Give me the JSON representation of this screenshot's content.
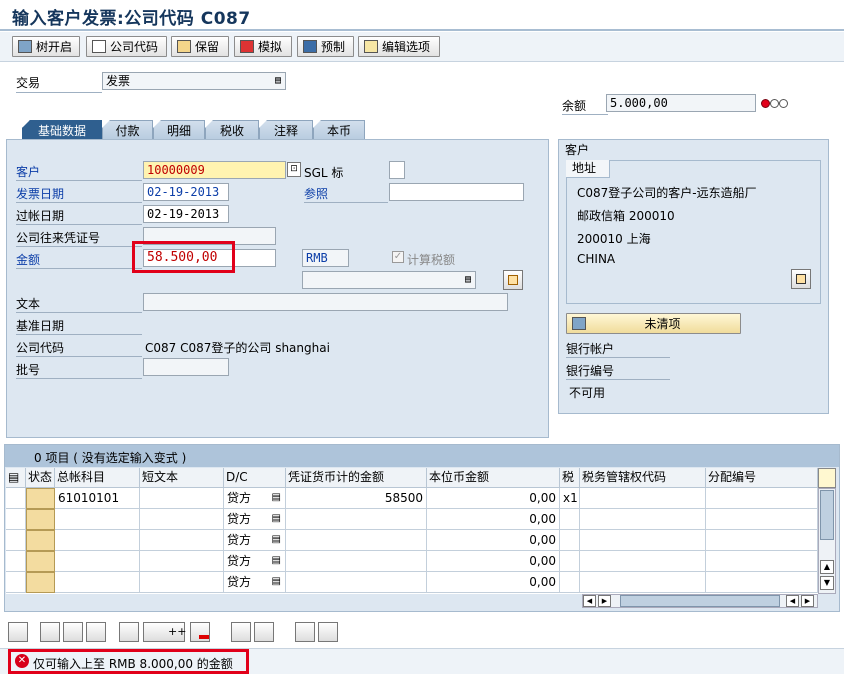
{
  "title": "输入客户发票:公司代码 C087",
  "toolbar": {
    "buttons": [
      {
        "label": "树开启",
        "icon": "tree-icon"
      },
      {
        "label": "公司代码",
        "icon": "company-code-icon"
      },
      {
        "label": "保留",
        "icon": "hold-icon"
      },
      {
        "label": "模拟",
        "icon": "simulate-icon"
      },
      {
        "label": "预制",
        "icon": "park-icon"
      },
      {
        "label": "编辑选项",
        "icon": "edit-options-icon"
      }
    ]
  },
  "transaction": {
    "label": "交易",
    "value": "发票"
  },
  "balance": {
    "label": "余额",
    "value": "5.000,00",
    "status_color": "#e3001b"
  },
  "tabs": [
    "基础数据",
    "付款",
    "明细",
    "税收",
    "注释",
    "本币"
  ],
  "basic": {
    "customer_label": "客户",
    "customer_value": "10000009",
    "sgl_label": "SGL 标",
    "invoice_date_label": "发票日期",
    "invoice_date_value": "02-19-2013",
    "reference_label": "参照",
    "posting_date_label": "过帐日期",
    "posting_date_value": "02-19-2013",
    "intercompany_label": "公司往来凭证号",
    "amount_label": "金额",
    "amount_value": "58.500,00",
    "currency": "RMB",
    "calc_tax_label": "计算税额",
    "text_label": "文本",
    "baseline_label": "基准日期",
    "company_label": "公司代码",
    "company_value": "C087 C087登子的公司 shanghai",
    "batch_label": "批号"
  },
  "customer_panel": {
    "title": "客户",
    "address_title": "地址",
    "address_lines": [
      "C087登子公司的客户-远东造船厂",
      "邮政信箱 200010",
      "200010 上海",
      "CHINA"
    ],
    "open_items_button": "未清项",
    "bank_account_label": "银行帐户",
    "bank_number_label": "银行编号",
    "unavailable_label": "不可用"
  },
  "items": {
    "header_text": "0 项目 ( 没有选定输入变式 )",
    "columns": [
      "状态",
      "总帐科目",
      "短文本",
      "D/C",
      "凭证货币计的金额",
      "本位币金额",
      "税",
      "税务管辖权代码",
      "分配编号"
    ],
    "rows": [
      {
        "gl": "61010101",
        "dc": "贷方",
        "doc_amount": "58500",
        "local_amount": "0,00",
        "tax": "x1"
      },
      {
        "gl": "",
        "dc": "贷方",
        "doc_amount": "",
        "local_amount": "0,00",
        "tax": ""
      },
      {
        "gl": "",
        "dc": "贷方",
        "doc_amount": "",
        "local_amount": "0,00",
        "tax": ""
      },
      {
        "gl": "",
        "dc": "贷方",
        "doc_amount": "",
        "local_amount": "0,00",
        "tax": ""
      },
      {
        "gl": "",
        "dc": "贷方",
        "doc_amount": "",
        "local_amount": "0,00",
        "tax": ""
      }
    ]
  },
  "status_message": "仅可输入上至 RMB 8.000,00 的金额",
  "colors": {
    "error_red": "#e1001a",
    "tab_active": "#2f5f8f",
    "panel_bg": "#dde7f1"
  }
}
